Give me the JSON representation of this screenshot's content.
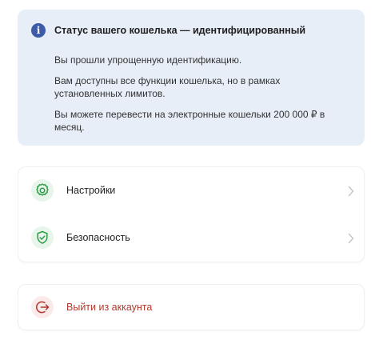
{
  "info": {
    "icon": "info-icon",
    "icon_glyph": "i",
    "title": "Статус вашего кошелька — идентифицированный",
    "line1": "Вы прошли упрощенную идентификацию.",
    "line2": "Вам доступны все функции кошелька, но в рамках установленных лимитов.",
    "line3": "Вы можете перевести на электронные кошельки 200 000 ₽ в месяц.",
    "accent_color": "#3d5ba9",
    "background": "#e8eef8"
  },
  "menu": {
    "items": [
      {
        "label": "Настройки",
        "icon": "gear-icon",
        "icon_color": "#2e9b47"
      },
      {
        "label": "Безопасность",
        "icon": "shield-check-icon",
        "icon_color": "#2e9b47"
      }
    ]
  },
  "logout": {
    "label": "Выйти из аккаунта",
    "icon": "logout-icon",
    "color": "#b03a2e"
  }
}
